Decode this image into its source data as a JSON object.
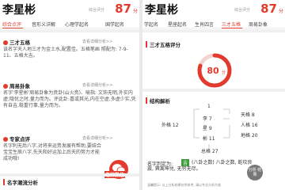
{
  "left": {
    "name": "李星彬",
    "score_label": "综合评分",
    "score": "87",
    "score_unit": "分",
    "tabs": [
      "综合点评",
      "音形义详解",
      "心理学起名",
      "国学起名"
    ],
    "sanshi": {
      "title": "三才五格",
      "detail": "去看详细分析>>",
      "text": "该名字天人地三才为金土水,配置佳。五格笔画 照配为: 7-9-11、五格大吉。"
    },
    "zhouyi": {
      "title": "周易卦象",
      "detail": "去看详细分析>>",
      "text": "名字'李星彬'周易卦象为贲卦(山火贲)、喻指: 文饰无明,外实内虚;隐忧之时,量力而为。评此卦:喜或其光,内在空虚,多虚少实,凭有自吉,稳重行事,量力而为。"
    },
    "expert": {
      "title": "专家点评",
      "detail": "去看详细分析>>",
      "text": "名字利无后八字,对将来运势发展有帮助,要结合宝宝生辰八字,先天和好运加上后天的努力才能成功哦!"
    },
    "wechat_label": "老师微信",
    "bottom_title": "名字潮流分析"
  },
  "right": {
    "name": "李星彬",
    "score_label": "综合评分",
    "score": "87",
    "score_unit": "分",
    "tabs": [
      "学起名",
      "星座起名",
      "生肖四言",
      "三才五格",
      "周易卦象"
    ],
    "section1_title": "三才五格评分",
    "ring_value": "80",
    "ring_unit": "分",
    "ring_fraction": 0.8,
    "section2_title": "结构解析",
    "grid": {
      "top": "1",
      "chars": [
        "李 7",
        "星 9",
        "彬 11"
      ],
      "outer": "外格 12",
      "tian": "天格 8",
      "ren": "人格 16",
      "di": "地格 20",
      "total": "总格 27"
    },
    "calc_text_1": "名字判定为:",
    "calc_badge": "吉",
    "calc_text_2": "(八卦之数) 八卦之数, 乾坎良震, 巽离坤兑, 无穷无尽。",
    "float_btn": "分析 结果",
    "bottom_note": "温馨提示: 以上分析结果仅供参考, 请以专业分析为准"
  }
}
